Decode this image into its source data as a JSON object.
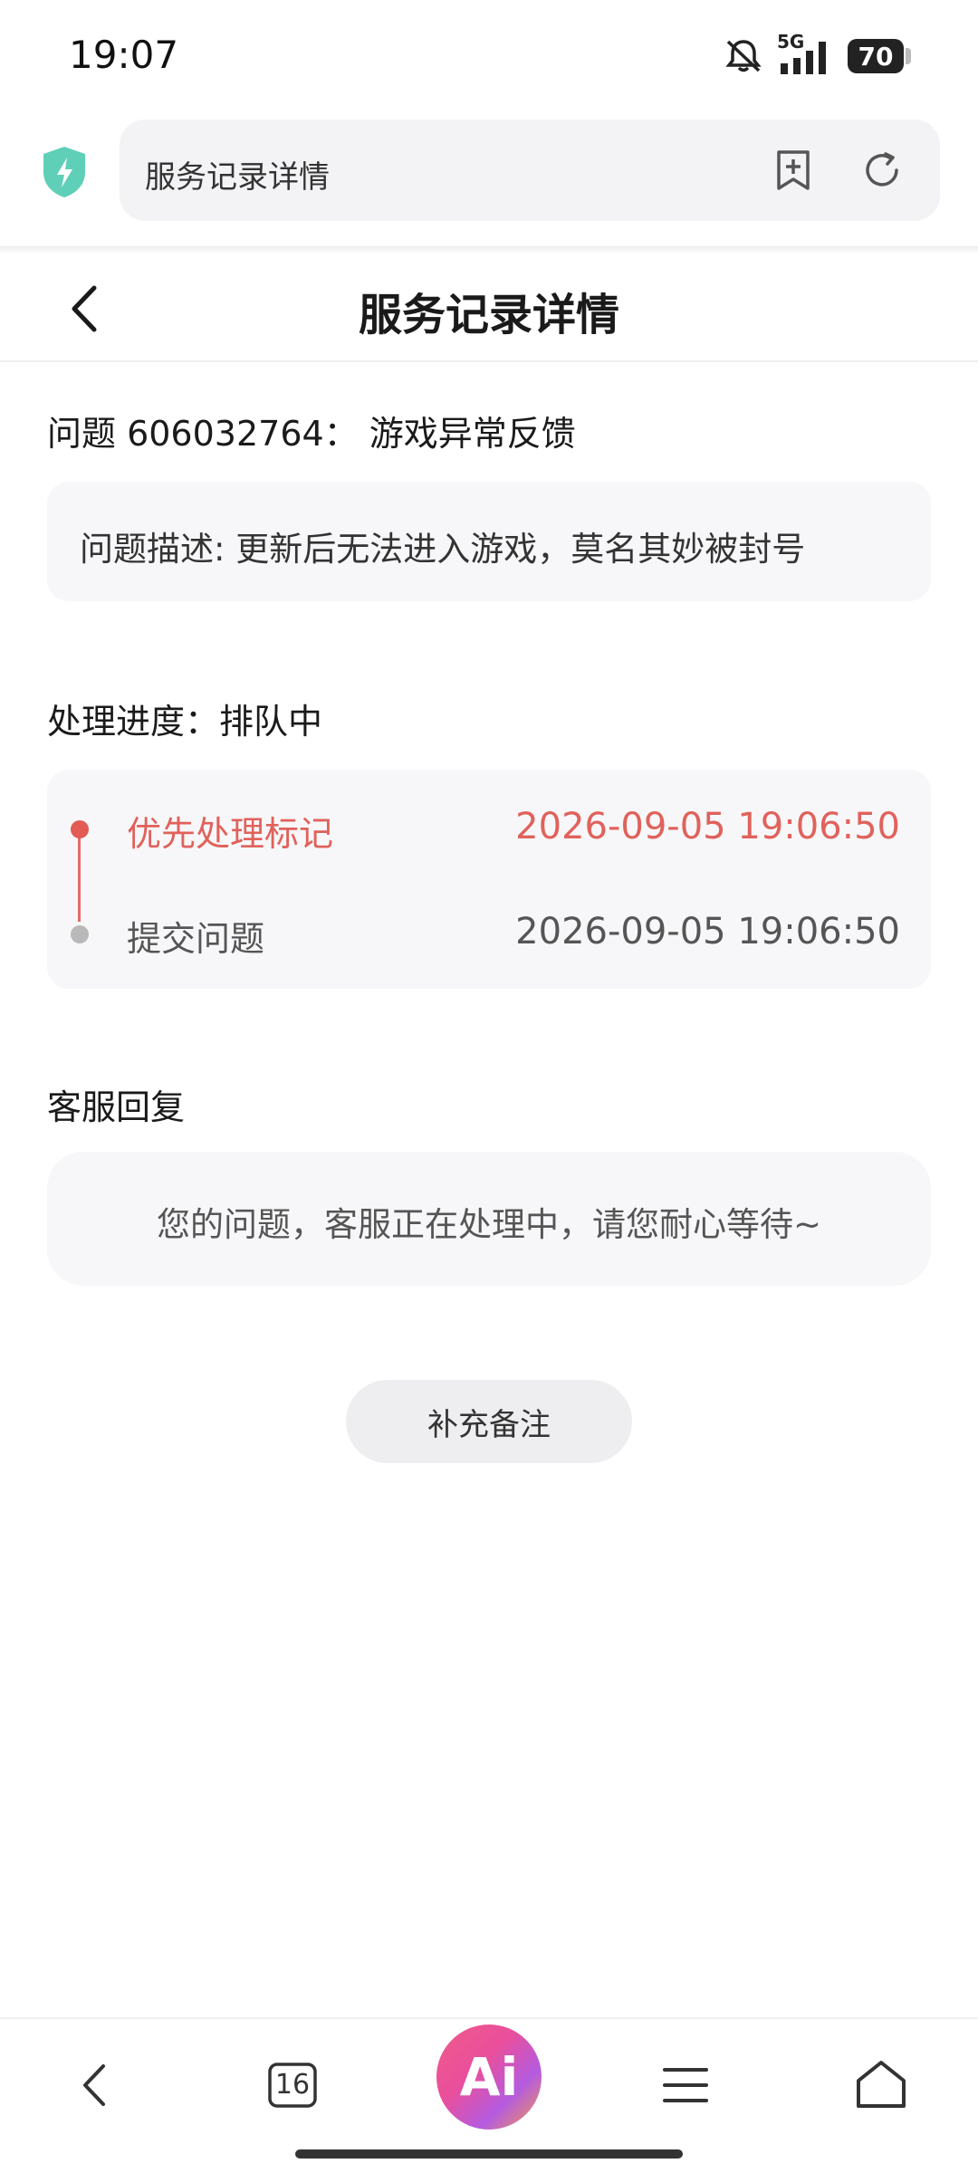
{
  "status_bar": {
    "time": "19:07",
    "network": "5G",
    "battery": "70"
  },
  "browser": {
    "address_text": "服务记录详情"
  },
  "header": {
    "title": "服务记录详情"
  },
  "question": {
    "title": "问题 606032764： 游戏异常反馈",
    "description": "问题描述: 更新后无法进入游戏，莫名其妙被封号"
  },
  "progress": {
    "title": "处理进度：排队中",
    "events": [
      {
        "label": "优先处理标记",
        "time": "2026-09-05 19:06:50",
        "color": "#e0625b"
      },
      {
        "label": "提交问题",
        "time": "2026-09-05 19:06:50",
        "color": "#555555"
      }
    ]
  },
  "reply": {
    "title": "客服回复",
    "text": "您的问题，客服正在处理中，请您耐心等待~"
  },
  "actions": {
    "supplement_label": "补充备注"
  },
  "bottom_bar": {
    "tab_count": "16",
    "ai_label": "Ai"
  }
}
